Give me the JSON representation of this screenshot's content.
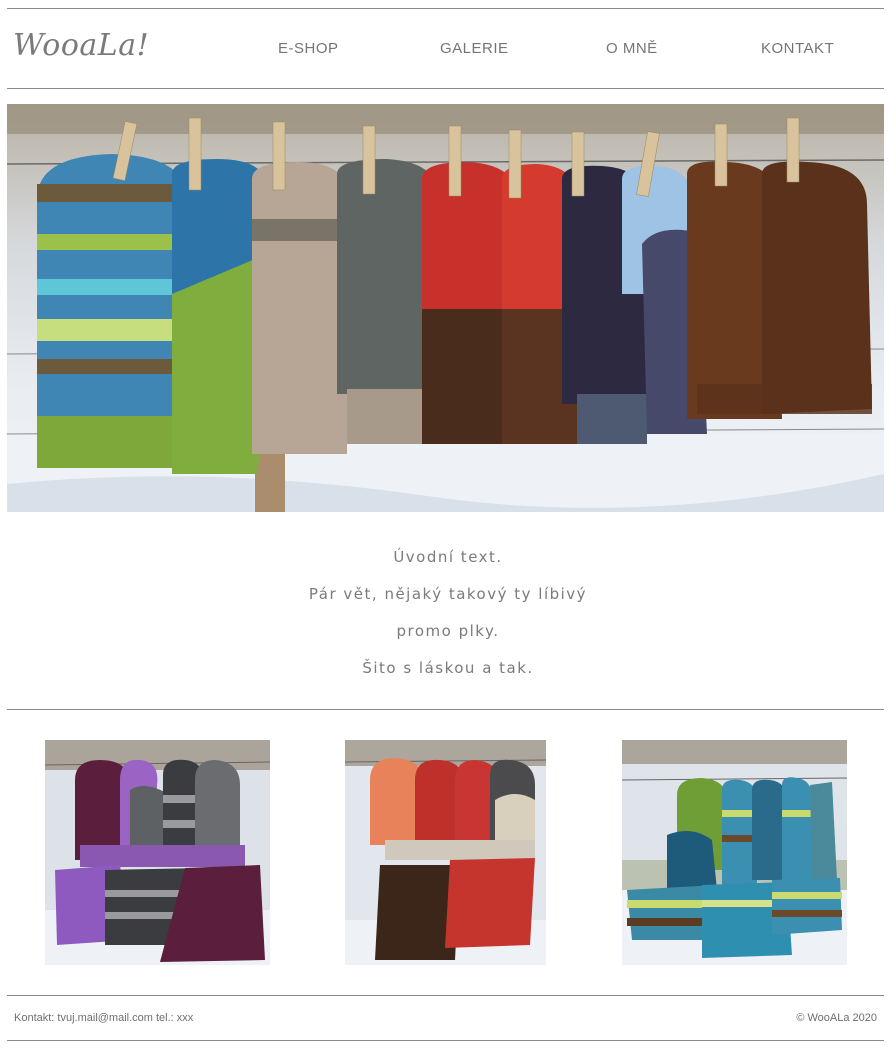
{
  "header": {
    "logo_text": "WooaLa!",
    "nav": [
      {
        "label": "E-SHOP"
      },
      {
        "label": "GALERIE"
      },
      {
        "label": "O MNĚ"
      },
      {
        "label": "KONTAKT"
      }
    ]
  },
  "intro": {
    "lines": [
      "Úvodní text.",
      "Pár vět, nějaký takový ty líbivý",
      "promo plky.",
      "Šito s láskou a tak."
    ]
  },
  "footer": {
    "contact": "Kontakt: tvuj.mail@mail.com tel.: xxx",
    "copyright": "© WooALa 2020"
  },
  "colors": {
    "text": "#757575",
    "rule": "#8a8a8a",
    "background": "#ffffff"
  }
}
